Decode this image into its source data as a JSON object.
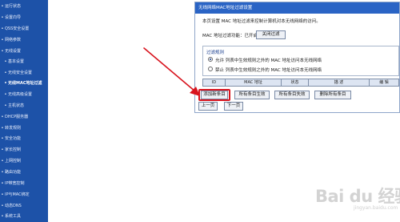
{
  "sidebar": {
    "items": [
      {
        "label": "运行状态",
        "sub": false
      },
      {
        "label": "设置向导",
        "sub": false
      },
      {
        "label": "QSS安全设置",
        "sub": false
      },
      {
        "label": "网络参数",
        "sub": false
      },
      {
        "label": "无线设置",
        "sub": false
      },
      {
        "label": "基本设置",
        "sub": true
      },
      {
        "label": "无线安全设置",
        "sub": true
      },
      {
        "label": "无线MAC地址过滤",
        "sub": true,
        "active": true
      },
      {
        "label": "无线高级设置",
        "sub": true
      },
      {
        "label": "主机状态",
        "sub": true
      },
      {
        "label": "DHCP服务器",
        "sub": false
      },
      {
        "label": "转发规则",
        "sub": false
      },
      {
        "label": "安全功能",
        "sub": false
      },
      {
        "label": "家长控制",
        "sub": false
      },
      {
        "label": "上网控制",
        "sub": false
      },
      {
        "label": "路由功能",
        "sub": false
      },
      {
        "label": "IP带宽控制",
        "sub": false
      },
      {
        "label": "IP与MAC绑定",
        "sub": false
      },
      {
        "label": "动态DNS",
        "sub": false
      },
      {
        "label": "系统工具",
        "sub": false
      }
    ]
  },
  "panel": {
    "title": "无线网络MAC地址过滤设置",
    "description": "本页设置 MAC 地址过滤来控制计算机对本无线网络的访问。",
    "status_label": "MAC 地址过滤功能：已开启",
    "disable_button": "关闭过滤",
    "filter_rule_label": "过滤规则",
    "allow_option": "允许 列表中生效规则之外的 MAC 地址访问本无线网络",
    "deny_option": "禁止 列表中生效规则之外的 MAC 地址访问本无线网络",
    "table_headers": [
      "ID",
      "MAC 地址",
      "状态",
      "描  述",
      "编 辑"
    ],
    "buttons": {
      "add": "添加新条目",
      "enable_all": "所有条目生效",
      "disable_all": "所有条目失效",
      "delete_all": "删除所有条目",
      "prev": "上一页",
      "next": "下一页"
    }
  },
  "colors": {
    "sidebar_bg": "#1d52a8",
    "title_bar": "#2a64c5",
    "highlight": "#d8141e",
    "arrow": "#d8141e"
  },
  "watermark": {
    "text": "Bai du 经验",
    "sub": "jingyan.baidu.com"
  }
}
